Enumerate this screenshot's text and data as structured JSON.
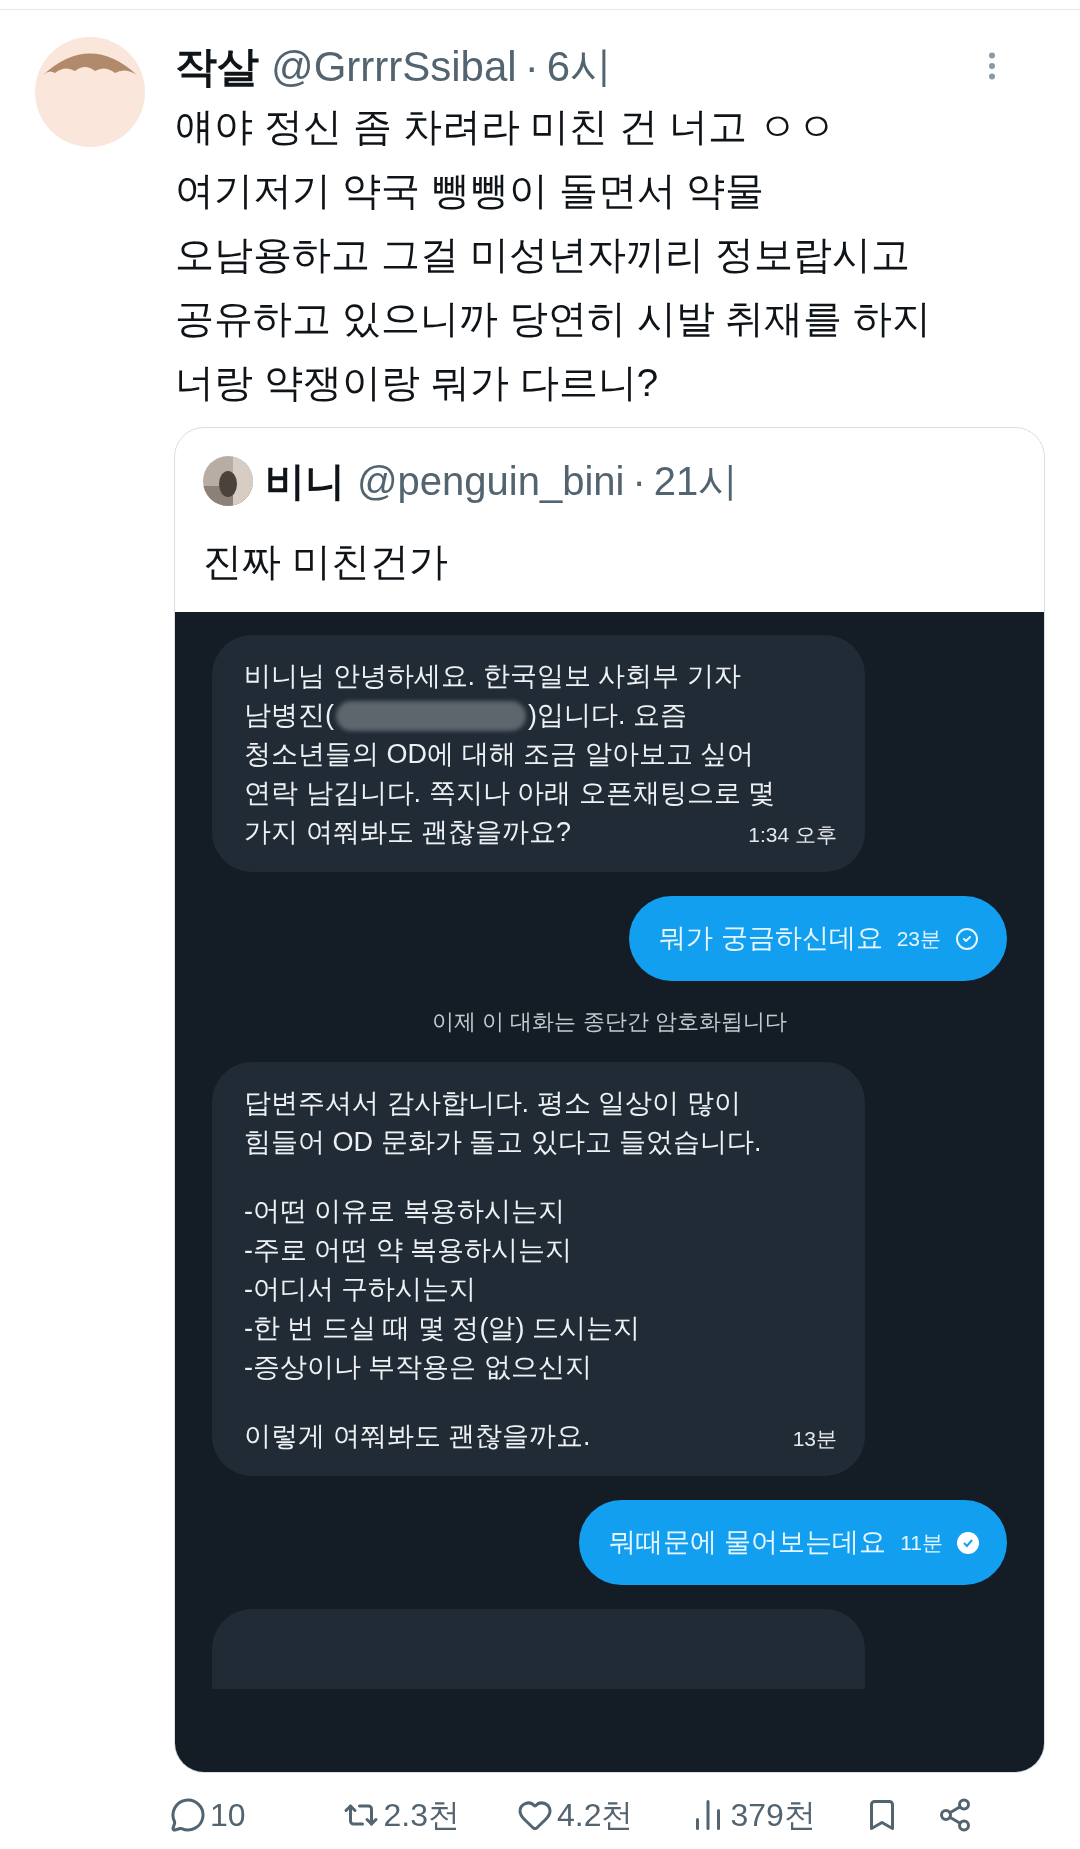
{
  "tweet": {
    "author": {
      "name": "작살",
      "handle": "@GrrrrSsibal",
      "separator": "·",
      "time": "6시"
    },
    "text_lines": [
      "얘야 정신 좀 차려라 미친 건 너고 ㅇㅇ",
      "여기저기 약국 뺑뺑이 돌면서 약물",
      "오남용하고 그걸 미성년자끼리 정보랍시고",
      "공유하고 있으니까 당연히 시발 취재를 하지",
      "너랑 약쟁이랑 뭐가 다르니?"
    ],
    "quote": {
      "author": {
        "name": "비니",
        "handle": "@penguin_bini",
        "separator": "·",
        "time": "21시"
      },
      "text": "진짜 미친건가",
      "chat": [
        {
          "kind": "received",
          "paragraphs": [
            [
              {
                "text": "비니님 안녕하세요. 한국일보 사회부 기자"
              },
              {
                "text": "남병진(",
                "redacted": true,
                "after": ")입니다. 요즘"
              },
              {
                "text": "청소년들의 OD에 대해 조금 알아보고 싶어"
              },
              {
                "text": "연락 남깁니다. 쪽지나 아래 오픈채팅으로 몇"
              },
              {
                "text": "가지 여쭤봐도 괜찮을까요?"
              }
            ]
          ],
          "time": "1:34 오후"
        },
        {
          "kind": "sent",
          "text": "뭐가 궁금하신데요",
          "time": "23분",
          "read": false
        },
        {
          "kind": "notice",
          "text": "이제 이 대화는 종단간 암호화됩니다"
        },
        {
          "kind": "received",
          "paragraphs": [
            [
              {
                "text": "답변주셔서 감사합니다. 평소 일상이 많이"
              },
              {
                "text": "힘들어 OD 문화가 돌고 있다고 들었습니다."
              }
            ],
            [
              {
                "text": "-어떤 이유로 복용하시는지"
              },
              {
                "text": "-주로 어떤 약 복용하시는지"
              },
              {
                "text": "-어디서 구하시는지"
              },
              {
                "text": "-한 번 드실 때 몇 정(알) 드시는지"
              },
              {
                "text": "-증상이나 부작용은 없으신지"
              }
            ],
            [
              {
                "text": "이렇게 여쭤봐도 괜찮을까요."
              }
            ]
          ],
          "time": "13분"
        },
        {
          "kind": "sent",
          "text": "뭐때문에 물어보는데요",
          "time": "11분",
          "read": true
        },
        {
          "kind": "cut"
        }
      ]
    },
    "actions": [
      {
        "kind": "reply",
        "count": "10"
      },
      {
        "kind": "repost",
        "count": "2.3천"
      },
      {
        "kind": "like",
        "count": "4.2천"
      },
      {
        "kind": "views",
        "count": "379천"
      },
      {
        "kind": "bookmark"
      },
      {
        "kind": "share"
      }
    ]
  }
}
